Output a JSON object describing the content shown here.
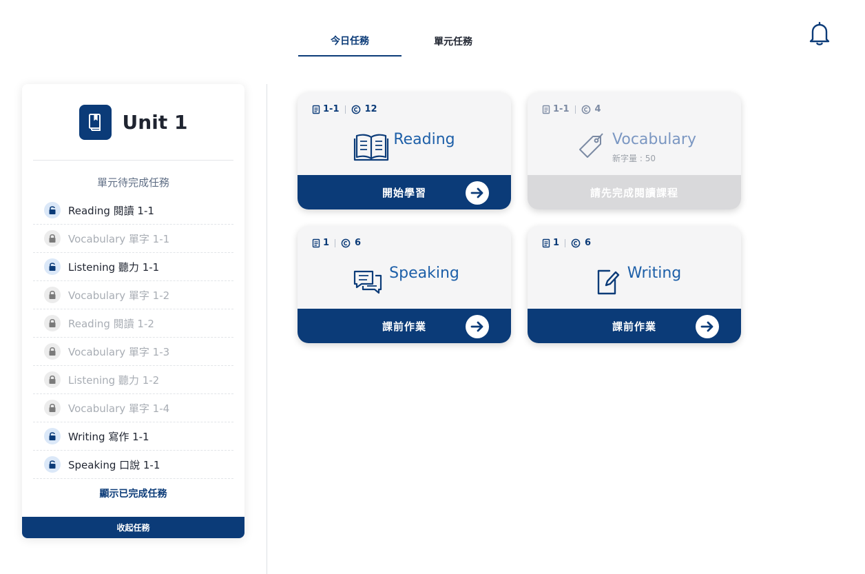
{
  "tabs": [
    {
      "label": "今日任務",
      "active": true
    },
    {
      "label": "單元任務",
      "active": false
    }
  ],
  "header": {
    "bell_icon": "bell-icon"
  },
  "sidebar": {
    "unit_title": "Unit 1",
    "unit_icon": "book-icon",
    "pending_title": "單元待完成任務",
    "tasks": [
      {
        "label": "Reading 閱讀 1-1",
        "locked": false
      },
      {
        "label": "Vocabulary 單字 1-1",
        "locked": true
      },
      {
        "label": "Listening 聽力 1-1",
        "locked": false
      },
      {
        "label": "Vocabulary 單字 1-2",
        "locked": true
      },
      {
        "label": "Reading 閱讀 1-2",
        "locked": true
      },
      {
        "label": "Vocabulary 單字 1-3",
        "locked": true
      },
      {
        "label": "Listening 聽力 1-2",
        "locked": true
      },
      {
        "label": "Vocabulary 單字 1-4",
        "locked": true
      },
      {
        "label": "Writing 寫作 1-1",
        "locked": false
      },
      {
        "label": "Speaking 口說 1-1",
        "locked": false
      }
    ],
    "show_done_label": "顯示已完成任務",
    "collapse_label": "收起任務"
  },
  "cards": [
    {
      "key": "reading",
      "lesson": "1-1",
      "coins": "12",
      "title": "Reading",
      "subtitle": "",
      "action": "開始學習",
      "enabled": true,
      "icon": "open-book-icon"
    },
    {
      "key": "vocabulary",
      "lesson": "1-1",
      "coins": "4",
      "title": "Vocabulary",
      "subtitle": "新字量 : 50",
      "action": "請先完成閱讀課程",
      "enabled": false,
      "icon": "tag-icon"
    },
    {
      "key": "speaking",
      "lesson": "1",
      "coins": "6",
      "title": "Speaking",
      "subtitle": "",
      "action": "課前作業",
      "enabled": true,
      "icon": "chat-bubbles-icon"
    },
    {
      "key": "writing",
      "lesson": "1",
      "coins": "6",
      "title": "Writing",
      "subtitle": "",
      "action": "課前作業",
      "enabled": true,
      "icon": "edit-note-icon"
    }
  ],
  "colors": {
    "primary": "#0b3b78",
    "accent": "#1d5fa8",
    "disabled": "#d9d9db"
  }
}
